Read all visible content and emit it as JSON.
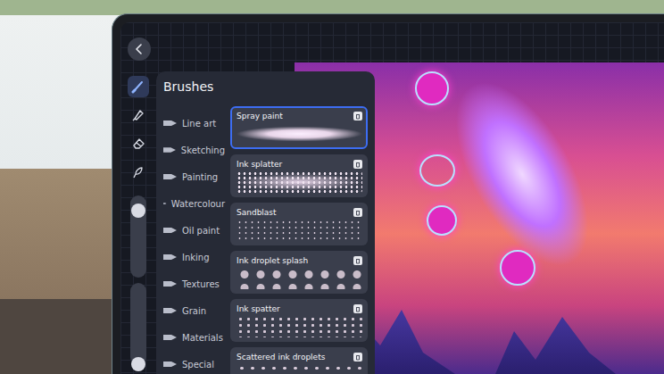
{
  "panel": {
    "title": "Brushes"
  },
  "tools": [
    {
      "kind": "brush",
      "selected": true
    },
    {
      "kind": "pen",
      "selected": false
    },
    {
      "kind": "eraser",
      "selected": false
    },
    {
      "kind": "smudge",
      "selected": false
    }
  ],
  "sliders": [
    {
      "name": "size",
      "level": 0.9
    },
    {
      "name": "opacity",
      "level": 0.1
    }
  ],
  "categories": [
    {
      "label": "Line art",
      "selected": false
    },
    {
      "label": "Sketching",
      "selected": false
    },
    {
      "label": "Painting",
      "selected": false
    },
    {
      "label": "Watercolour",
      "selected": false
    },
    {
      "label": "Oil paint",
      "selected": false
    },
    {
      "label": "Inking",
      "selected": false
    },
    {
      "label": "Textures",
      "selected": false
    },
    {
      "label": "Grain",
      "selected": false
    },
    {
      "label": "Materials",
      "selected": false
    },
    {
      "label": "Special",
      "selected": false
    }
  ],
  "brushes": [
    {
      "name": "Spray paint",
      "kind": "spray",
      "selected": true
    },
    {
      "name": "Ink splatter",
      "kind": "splatter",
      "selected": false
    },
    {
      "name": "Sandblast",
      "kind": "sand",
      "selected": false
    },
    {
      "name": "Ink droplet splash",
      "kind": "droplets",
      "selected": false
    },
    {
      "name": "Ink spatter",
      "kind": "spatter",
      "selected": false
    },
    {
      "name": "Scattered ink droplets",
      "kind": "scattered",
      "selected": false
    }
  ]
}
